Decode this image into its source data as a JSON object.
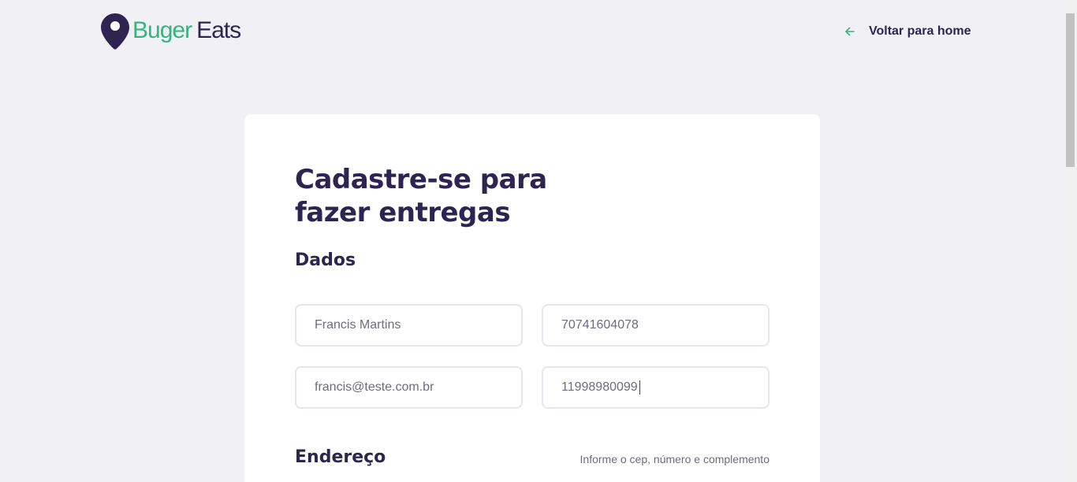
{
  "header": {
    "logo": {
      "buger": "Buger",
      "eats": "Eats"
    },
    "back_link": {
      "label": "Voltar para home",
      "icon": "arrow-left-icon"
    }
  },
  "form": {
    "title": "Cadastre-se para fazer entregas",
    "section_dados": "Dados",
    "fields": {
      "name": {
        "value": "Francis Martins"
      },
      "cpf": {
        "value": "70741604078"
      },
      "email": {
        "value": "francis@teste.com.br"
      },
      "whatsapp": {
        "value": "11998980099"
      }
    },
    "section_endereco": "Endereço",
    "endereco_hint": "Informe o cep, número e complemento"
  },
  "colors": {
    "background": "#f0f0f5",
    "brand_purple": "#2d2451",
    "brand_green": "#36b37e",
    "input_border": "#e6e6f0",
    "card": "#ffffff"
  }
}
